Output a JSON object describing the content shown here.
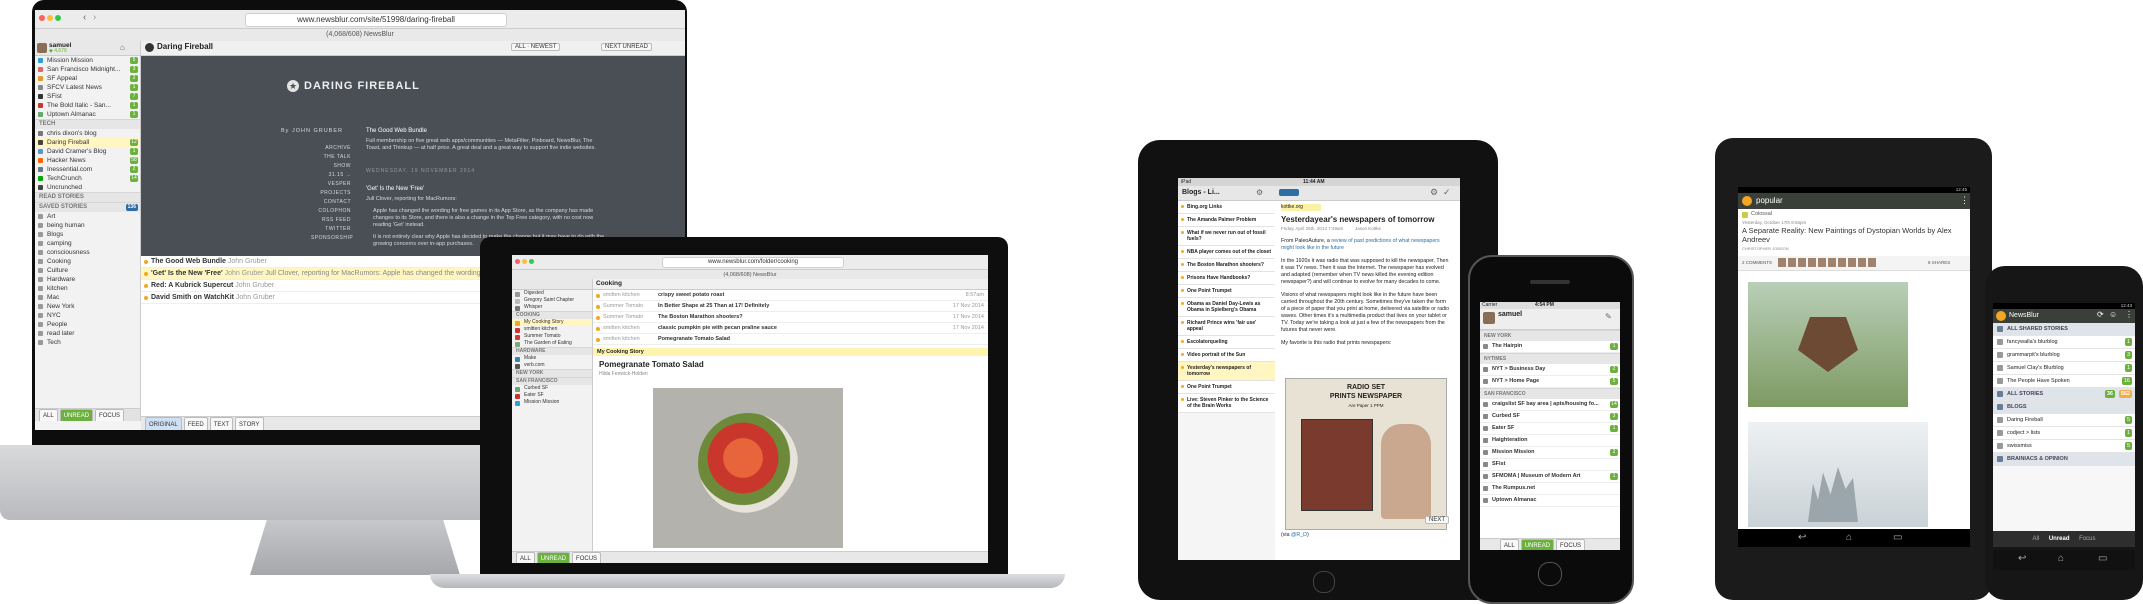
{
  "imac": {
    "url": "www.newsblur.com/site/51998/daring-fireball",
    "window_title": "(4,068/608) NewsBlur",
    "user": "samuel",
    "user_stats": "◆ 4,678",
    "feed_title": "Daring Fireball",
    "toolbar_filter": "ALL · NEWEST",
    "mark_read": "NEXT UNREAD",
    "feeds": [
      {
        "name": "Mission Mission",
        "count": "5",
        "color": "#2e9fd6"
      },
      {
        "name": "San Francisco Midnight...",
        "count": "3",
        "color": "#d66"
      },
      {
        "name": "SF Appeal",
        "count": "2",
        "color": "#e39a2d"
      },
      {
        "name": "SFCV Latest News",
        "count": "1",
        "color": "#888"
      },
      {
        "name": "SFist",
        "count": "7",
        "color": "#333"
      },
      {
        "name": "The Bold Italic - San...",
        "count": "1",
        "color": "#c33"
      },
      {
        "name": "Uptown Almanac",
        "count": "1",
        "color": "#6a6"
      }
    ],
    "folder_tech": "TECH",
    "tech_feeds": [
      {
        "name": "chris dixon's blog",
        "count": "",
        "color": "#777"
      },
      {
        "name": "Daring Fireball",
        "count": "12",
        "color": "#444"
      },
      {
        "name": "David Cramer's Blog",
        "count": "1",
        "color": "#59c"
      },
      {
        "name": "Hacker News",
        "count": "58",
        "color": "#f60"
      },
      {
        "name": "Inessential.com",
        "count": "2",
        "color": "#678"
      },
      {
        "name": "TechCrunch",
        "count": "14",
        "color": "#0a0"
      },
      {
        "name": "Uncrunched",
        "count": "",
        "color": "#444"
      }
    ],
    "read_stories": "READ STORIES",
    "saved_stories": "SAVED STORIES",
    "saved_count": "136",
    "tags": [
      "Art",
      "being human",
      "Blogs",
      "camping",
      "consciousness",
      "Cooking",
      "Culture",
      "Hardware",
      "kitchen",
      "Mac",
      "New York",
      "NYC",
      "People",
      "read later",
      "Tech"
    ],
    "df_logo": "DARING FIREBALL",
    "df_byline": "By JOHN GRUBER",
    "df_nav": [
      "ARCHIVE",
      "THE TALK SHOW",
      "31.15 → VESPER",
      "PROJECTS",
      "CONTACT",
      "COLOPHON",
      "RSS FEED",
      "TWITTER",
      "SPONSORSHIP"
    ],
    "post1_title": "The Good Web Bundle",
    "post1_body": "Full membership on five great web apps/communities — MetaFilter, Pinboard, NewsBlur, The Toast, and Thinkup — at half price. A great deal and a great way to support five indie websites.",
    "date_line": "WEDNESDAY, 19 NOVEMBER 2014",
    "post2_title": "'Get' Is the New 'Free'",
    "post2_author": "Jull Clover, reporting for MacRumors:",
    "post2_body": "Apple has changed the wording for free games in its App Store, as the company has made changes to its Store, and there is also a change in the Top Free category, with no cost now reading 'Get' instead.",
    "post2_body2": "It is not entirely clear why Apple has decided to make the change but it may have to do with the growing concerns over in-app purchases.",
    "stories": [
      {
        "title": "The Good Web Bundle",
        "author": "John Gruber",
        "snippet": ""
      },
      {
        "title": "'Get' Is the New 'Free'",
        "author": "John Gruber",
        "snippet": "Jull Clover, reporting for MacRumors: Apple has changed the wording for free games in its App Store, and the app purchase buttons that on..."
      },
      {
        "title": "Red: A Kubrick Supercut",
        "author": "John Gruber",
        "snippet": ""
      },
      {
        "title": "David Smith on WatchKit",
        "author": "John Gruber",
        "snippet": ""
      }
    ],
    "bottom_toolbar": [
      "ALL",
      "UNREAD",
      "FOCUS"
    ],
    "view_tabs": [
      "ORIGINAL",
      "FEED",
      "TEXT",
      "STORY"
    ]
  },
  "macbook": {
    "url": "www.newsblur.com/folder/cooking",
    "window_title": "(4,068/608) NewsBlur",
    "folder_title": "Cooking",
    "story_rows": [
      {
        "feed": "smitten kitchen",
        "title": "crispy sweet potato roast",
        "date": "8:57am"
      },
      {
        "feed": "Summer Tomato",
        "title": "In Better Shape at 25 Than at 17! Definitely",
        "date": "17 Nov 2014"
      },
      {
        "feed": "Summer Tomato",
        "title": "The Boston Marathon shooters?",
        "date": "17 Nov 2014"
      },
      {
        "feed": "smitten kitchen",
        "title": "classic pumpkin pie with pecan praline sauce",
        "date": "17 Nov 2014"
      },
      {
        "feed": "smitten kitchen",
        "title": "Pomegranate Tomato Salad",
        "date": ""
      }
    ],
    "story_title": "Pomegranate Tomato Salad",
    "story_meta": "Hilda Fenwick-Holden",
    "sidebar_label_story": "My Cooking Story",
    "bottom_tabs": [
      "ALL",
      "UNREAD",
      "FOCUS"
    ]
  },
  "ipad": {
    "status_time": "11:44 AM",
    "carrier": "iPad",
    "left_title": "Blogs - Li...",
    "left_items": [
      {
        "title": "Bing.org Links",
        "meta": ""
      },
      {
        "title": "The Amanda Palmer Problem",
        "meta": ""
      },
      {
        "title": "What if we never run out of fossil fuels?",
        "meta": ""
      },
      {
        "title": "NBA player comes out of the closet",
        "meta": ""
      },
      {
        "title": "The Boston Marathon shooters?",
        "meta": ""
      },
      {
        "title": "Prisons Have Handbooks?",
        "meta": ""
      },
      {
        "title": "One Point Trumpet",
        "meta": ""
      },
      {
        "title": "Obama as Daniel Day-Lewis as Obama in Spielberg's Obama",
        "meta": ""
      },
      {
        "title": "Richard Prince wins 'fair use' appeal",
        "meta": ""
      },
      {
        "title": "Escolatorqueling",
        "meta": ""
      },
      {
        "title": "Video portrait of the Sun",
        "meta": ""
      },
      {
        "title": "Yesterday's newspapers of tomorrow",
        "meta": ""
      },
      {
        "title": "One Point Trumpet",
        "meta": ""
      },
      {
        "title": "Live: Steven Pinker to the Science of the Brain Works",
        "meta": ""
      }
    ],
    "article_source": "kottke.org",
    "article_title": "Yesterdayear's newspapers of tomorrow",
    "article_date": "Friday, April 26th, 2013 7:49am",
    "article_author": "Jason Kottke",
    "para1_lead": "From PaleoAuture, a ",
    "para1_link": "review of past predictions of what newspapers might look like in the future",
    "para2": "In the 1920s it was radio that was supposed to kill the newspaper. Then it was TV news. Then it was the Internet. The newspaper has evolved and adapted (remember when TV news killed the evening edition newspaper?) and will continue to evolve for many decades to come.",
    "para3": "Visions of what newspapers might look like in the future have been carried throughout the 20th century. Sometimes they've taken the form of a piece of paper that you print at home, delivered via satellite or radio waves. Other times it's a multimedia product that lives on your tablet or TV. Today we're taking a look at just a few of the newspapers from the futures that never were.",
    "para4": "My favorite is this radio that prints newspapers:",
    "poster_line1": "RADIO SET",
    "poster_line2": "PRINTS NEWSPAPER",
    "poster_price": "Are Paper 1 PPM",
    "via": "(via ",
    "via_link": "@R_D",
    "via_end": ")",
    "next_label": "NEXT"
  },
  "iphone": {
    "carrier": "Carrier",
    "time": "4:54 PM",
    "user": "samuel",
    "sections": [
      {
        "type": "folder",
        "label": "NEW YORK"
      },
      {
        "type": "feed",
        "label": "The Hairpin",
        "count": "1"
      },
      {
        "type": "folder",
        "label": "NYTIMES"
      },
      {
        "type": "feed",
        "label": "NYT > Business Day",
        "count": "2"
      },
      {
        "type": "feed",
        "label": "NYT > Home Page",
        "count": "5"
      },
      {
        "type": "folder",
        "label": "SAN FRANCISCO"
      },
      {
        "type": "feed",
        "label": "craigslist SF bay area | apts/housing fo...",
        "count": "14"
      },
      {
        "type": "feed",
        "label": "Curbed SF",
        "count": "3"
      },
      {
        "type": "feed",
        "label": "Eater SF",
        "count": "1"
      },
      {
        "type": "feed",
        "label": "Haighteration",
        "count": ""
      },
      {
        "type": "feed",
        "label": "Mission Mission",
        "count": "2"
      },
      {
        "type": "feed",
        "label": "SFist",
        "count": ""
      },
      {
        "type": "feed",
        "label": "SFMOMA | Museum of Modern Art",
        "count": "1"
      },
      {
        "type": "feed",
        "label": "The Rumpus.net",
        "count": ""
      },
      {
        "type": "feed",
        "label": "Uptown Almanac",
        "count": ""
      }
    ],
    "bottom": [
      "ALL",
      "UNREAD",
      "FOCUS"
    ]
  },
  "android_tablet": {
    "status_time": "12:45",
    "header_title": "popular",
    "feed_name": "Colossal",
    "date": "Yesterday, October 17th 8:56pm",
    "title": "A Separate Reality: New Paintings of Dystopian Worlds by Alex Andreev",
    "author": "CHRISTOPHER JOBSON",
    "comments": "2 COMMENTS",
    "shares": "8 SHARES"
  },
  "android_phone": {
    "status_time": "12:43",
    "app_title": "NewsBlur",
    "rows": [
      {
        "type": "header",
        "label": "ALL SHARED STORIES",
        "count": ""
      },
      {
        "type": "feed",
        "label": "fancywalla's blurblog",
        "count": "1"
      },
      {
        "type": "feed",
        "label": "grammarpit's blurblog",
        "count": "3"
      },
      {
        "type": "feed",
        "label": "Samuel Clay's Blurblog",
        "count": "1"
      },
      {
        "type": "feed",
        "label": "The People Have Spoken",
        "count": "16"
      },
      {
        "type": "header",
        "label": "ALL STORIES",
        "count": "562"
      },
      {
        "type": "header",
        "label": "BLOGS",
        "count": ""
      },
      {
        "type": "feed",
        "label": "Daring Fireball",
        "count": "5"
      },
      {
        "type": "feed",
        "label": "codject > lists",
        "count": "1"
      },
      {
        "type": "feed",
        "label": "swissmiss",
        "count": "5"
      },
      {
        "type": "header",
        "label": "BRAINIACS & OPINION",
        "count": ""
      }
    ],
    "all_stories_count2": "36",
    "bottom": [
      "All",
      "Unread",
      "Focus"
    ]
  },
  "colors": {
    "newsblur_green": "#6cb13f",
    "folder_grey": "#e6e6e6",
    "selection_yellow": "#fff6c2",
    "df_background": "#4a4f55",
    "android_dark": "#3a3f3a"
  }
}
